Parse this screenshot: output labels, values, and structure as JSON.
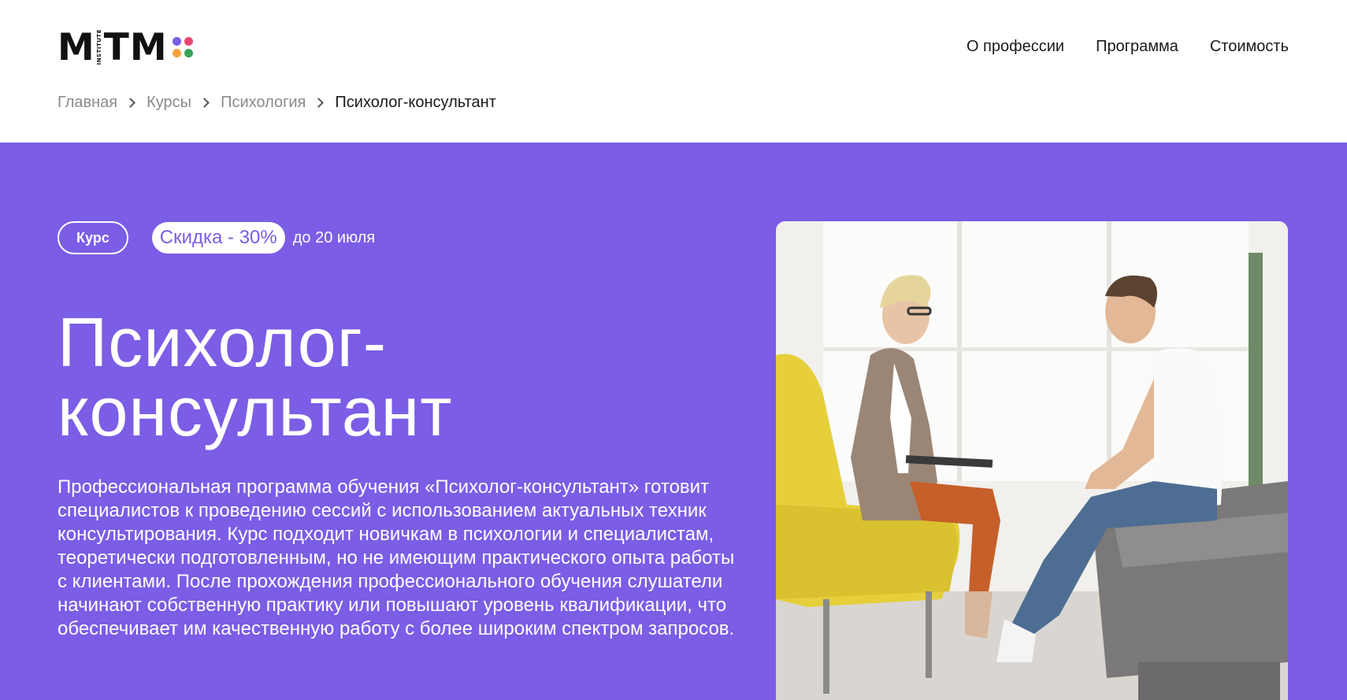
{
  "logo": {
    "text": "MITM",
    "sub": "INSTITUTE",
    "dot_colors": [
      "#7b5de6",
      "#e8476b",
      "#f2a33a",
      "#3aa15a"
    ]
  },
  "nav": {
    "items": [
      {
        "label": "О профессии"
      },
      {
        "label": "Программа"
      },
      {
        "label": "Стоимость"
      }
    ]
  },
  "breadcrumb": {
    "items": [
      {
        "label": "Главная"
      },
      {
        "label": "Курсы"
      },
      {
        "label": "Психология"
      }
    ],
    "current": "Психолог-консультант"
  },
  "hero": {
    "background": "#7b5de6",
    "badge_type": "Курс",
    "discount": "Скидка - 30%",
    "discount_until": "до 20 июля",
    "title_line1": "Психолог-",
    "title_line2": "консультант",
    "description": "Профессиональная программа обучения «Психолог-консультант» готовит специалистов к проведению сессий с использованием актуальных техник консультирования. Курс подходит новичкам в психологии и специалистам, теоретически подготовленным, но не имеющим практического опыта работы с клиентами. После прохождения профессионального обучения слушатели начинают собственную практику или повышают уровень квалификации, что обеспечивает им качественную работу с более широким спектром запросов."
  }
}
